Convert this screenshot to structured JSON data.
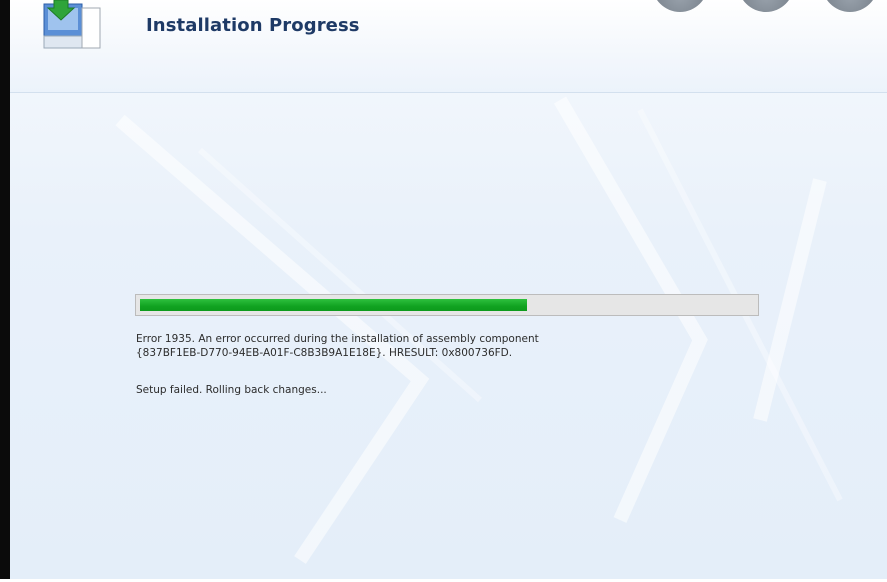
{
  "header": {
    "title": "Installation Progress",
    "icon": "setup-package-icon"
  },
  "progress": {
    "value_percent": 63,
    "color": "#13a524"
  },
  "messages": {
    "error_line1": "Error 1935. An error occurred during the installation of assembly component",
    "error_line2": "{837BF1EB-D770-94EB-A01F-C8B3B9A1E18E}. HRESULT: 0x800736FD.",
    "status": "Setup failed.  Rolling back changes..."
  },
  "colors": {
    "title": "#1e3a66",
    "background": "#e9f1fa"
  }
}
